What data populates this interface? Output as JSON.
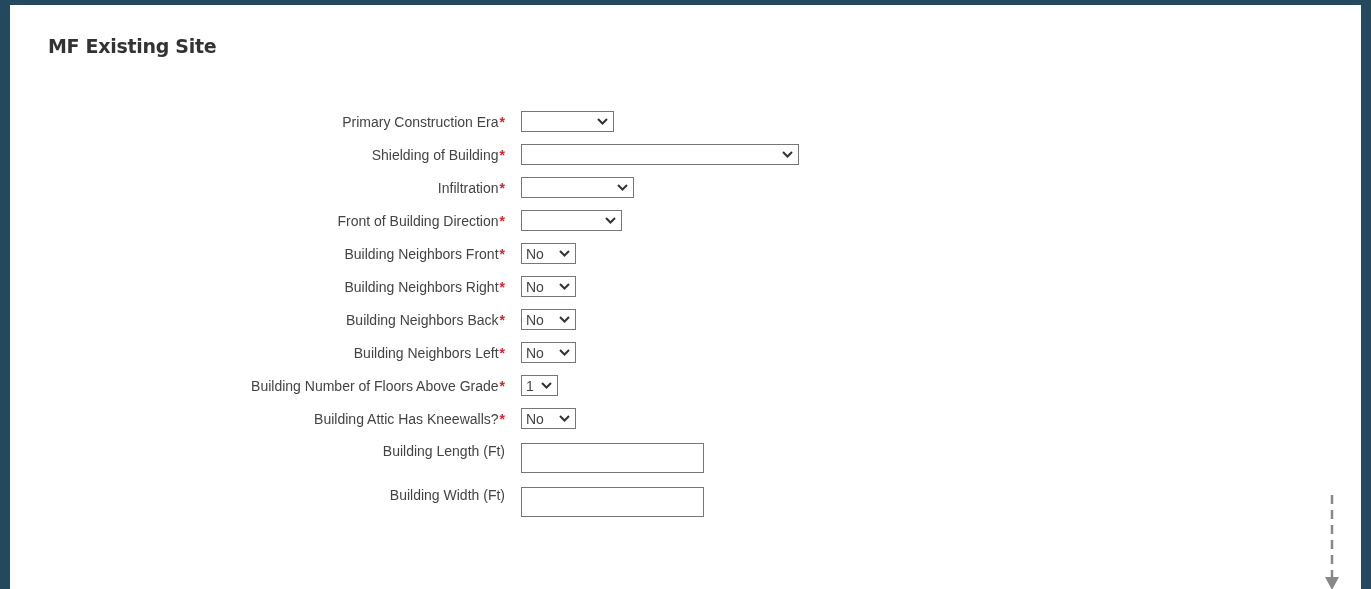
{
  "panel": {
    "title": "MF Existing Site"
  },
  "fields": [
    {
      "kind": "select",
      "label": "Primary Construction Era",
      "required_mark": "*"
    },
    {
      "kind": "select",
      "label": "Shielding of Building",
      "required_mark": "*"
    },
    {
      "kind": "select",
      "label": "Infiltration",
      "required_mark": "*"
    },
    {
      "kind": "select",
      "label": "Front of Building Direction",
      "required_mark": "*"
    },
    {
      "kind": "select",
      "label": "Building Neighbors Front",
      "required_mark": "*",
      "value": "No"
    },
    {
      "kind": "select",
      "label": "Building Neighbors Right",
      "required_mark": "*",
      "value": "No"
    },
    {
      "kind": "select",
      "label": "Building Neighbors Back",
      "required_mark": "*",
      "value": "No"
    },
    {
      "kind": "select",
      "label": "Building Neighbors Left",
      "required_mark": "*",
      "value": "No"
    },
    {
      "kind": "select",
      "label": "Building Number of Floors Above Grade",
      "required_mark": "*",
      "value": "1"
    },
    {
      "kind": "select",
      "label": "Building Attic Has Kneewalls?",
      "required_mark": "*",
      "value": "No"
    },
    {
      "kind": "text",
      "label": "Building Length (Ft)"
    },
    {
      "kind": "text",
      "label": "Building Width (Ft)"
    }
  ]
}
